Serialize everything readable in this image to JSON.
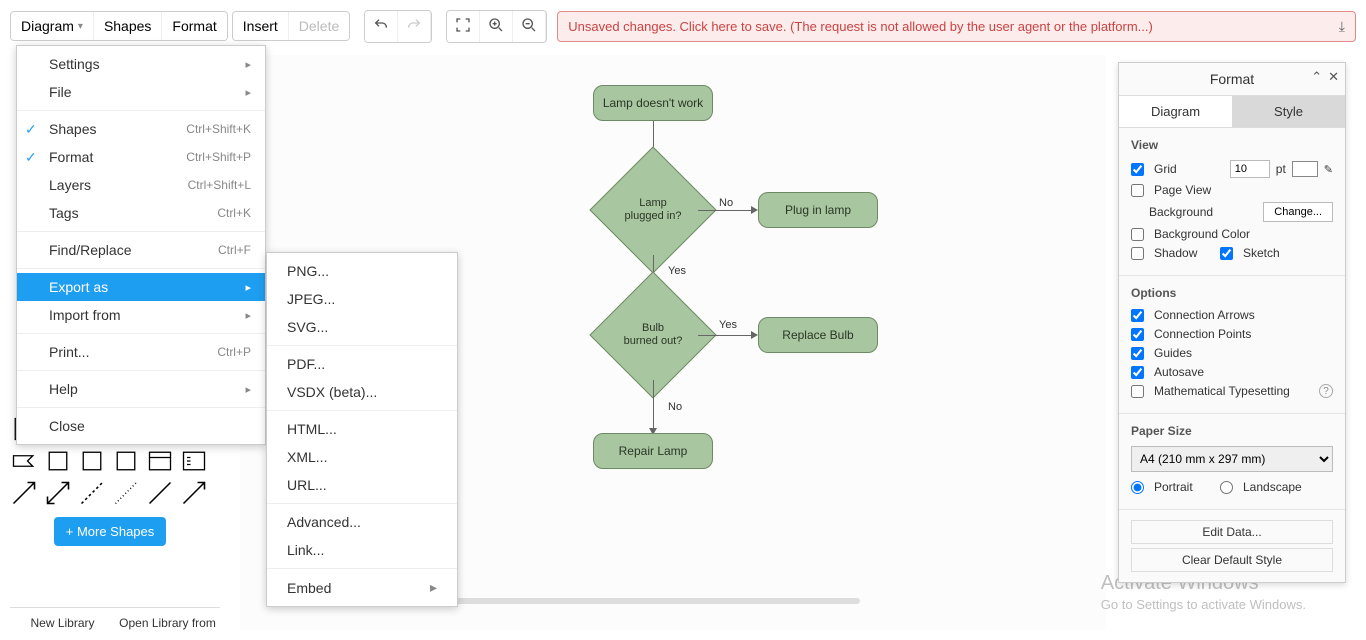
{
  "toolbar": {
    "diagram_label": "Diagram",
    "shapes_label": "Shapes",
    "format_label": "Format",
    "insert_label": "Insert",
    "delete_label": "Delete"
  },
  "warning": {
    "text": "Unsaved changes. Click here to save. (The request is not allowed by the user agent or the platform...)"
  },
  "diagram_menu": {
    "settings": "Settings",
    "file": "File",
    "shapes": "Shapes",
    "shapes_short": "Ctrl+Shift+K",
    "format": "Format",
    "format_short": "Ctrl+Shift+P",
    "layers": "Layers",
    "layers_short": "Ctrl+Shift+L",
    "tags": "Tags",
    "tags_short": "Ctrl+K",
    "find": "Find/Replace",
    "find_short": "Ctrl+F",
    "export_as": "Export as",
    "import_from": "Import from",
    "print": "Print...",
    "print_short": "Ctrl+P",
    "help": "Help",
    "close": "Close"
  },
  "export_submenu": {
    "png": "PNG...",
    "jpeg": "JPEG...",
    "svg": "SVG...",
    "pdf": "PDF...",
    "vsdx": "VSDX (beta)...",
    "html": "HTML...",
    "xml": "XML...",
    "url": "URL...",
    "advanced": "Advanced...",
    "link": "Link...",
    "embed": "Embed"
  },
  "shapes_panel": {
    "more": "+ More Shapes",
    "new_library": "New Library",
    "open_library": "Open Library from"
  },
  "flow": {
    "n1": "Lamp doesn't work",
    "n2": "Lamp\nplugged in?",
    "n3": "Plug in lamp",
    "n4": "Bulb\nburned out?",
    "n5": "Replace Bulb",
    "n6": "Repair Lamp",
    "yes": "Yes",
    "no": "No"
  },
  "format_panel": {
    "title": "Format",
    "tab_diagram": "Diagram",
    "tab_style": "Style",
    "view": "View",
    "grid": "Grid",
    "grid_value": "10",
    "grid_unit": "pt",
    "page_view": "Page View",
    "background": "Background",
    "change": "Change...",
    "bg_color": "Background Color",
    "shadow": "Shadow",
    "sketch": "Sketch",
    "options": "Options",
    "conn_arrows": "Connection Arrows",
    "conn_points": "Connection Points",
    "guides": "Guides",
    "autosave": "Autosave",
    "math": "Mathematical Typesetting",
    "paper_size": "Paper Size",
    "paper_value": "A4 (210 mm x 297 mm)",
    "portrait": "Portrait",
    "landscape": "Landscape",
    "edit_data": "Edit Data...",
    "clear_style": "Clear Default Style"
  },
  "watermark": {
    "line1": "Activate Windows",
    "line2": "Go to Settings to activate Windows."
  },
  "chart_data": {
    "type": "flowchart",
    "nodes": [
      {
        "id": "n1",
        "shape": "rounded-rect",
        "label": "Lamp doesn't work"
      },
      {
        "id": "n2",
        "shape": "diamond",
        "label": "Lamp plugged in?"
      },
      {
        "id": "n3",
        "shape": "rounded-rect",
        "label": "Plug in lamp"
      },
      {
        "id": "n4",
        "shape": "diamond",
        "label": "Bulb burned out?"
      },
      {
        "id": "n5",
        "shape": "rounded-rect",
        "label": "Replace Bulb"
      },
      {
        "id": "n6",
        "shape": "rounded-rect",
        "label": "Repair Lamp"
      }
    ],
    "edges": [
      {
        "from": "n1",
        "to": "n2",
        "label": ""
      },
      {
        "from": "n2",
        "to": "n3",
        "label": "No"
      },
      {
        "from": "n2",
        "to": "n4",
        "label": "Yes"
      },
      {
        "from": "n4",
        "to": "n5",
        "label": "Yes"
      },
      {
        "from": "n4",
        "to": "n6",
        "label": "No"
      }
    ]
  }
}
